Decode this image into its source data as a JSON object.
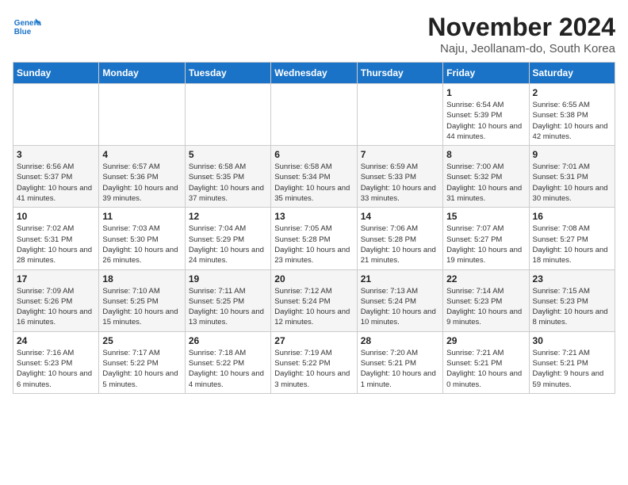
{
  "logo": {
    "line1": "General",
    "line2": "Blue"
  },
  "title": "November 2024",
  "subtitle": "Naju, Jeollanam-do, South Korea",
  "days_of_week": [
    "Sunday",
    "Monday",
    "Tuesday",
    "Wednesday",
    "Thursday",
    "Friday",
    "Saturday"
  ],
  "weeks": [
    [
      {
        "day": "",
        "info": ""
      },
      {
        "day": "",
        "info": ""
      },
      {
        "day": "",
        "info": ""
      },
      {
        "day": "",
        "info": ""
      },
      {
        "day": "",
        "info": ""
      },
      {
        "day": "1",
        "info": "Sunrise: 6:54 AM\nSunset: 5:39 PM\nDaylight: 10 hours and 44 minutes."
      },
      {
        "day": "2",
        "info": "Sunrise: 6:55 AM\nSunset: 5:38 PM\nDaylight: 10 hours and 42 minutes."
      }
    ],
    [
      {
        "day": "3",
        "info": "Sunrise: 6:56 AM\nSunset: 5:37 PM\nDaylight: 10 hours and 41 minutes."
      },
      {
        "day": "4",
        "info": "Sunrise: 6:57 AM\nSunset: 5:36 PM\nDaylight: 10 hours and 39 minutes."
      },
      {
        "day": "5",
        "info": "Sunrise: 6:58 AM\nSunset: 5:35 PM\nDaylight: 10 hours and 37 minutes."
      },
      {
        "day": "6",
        "info": "Sunrise: 6:58 AM\nSunset: 5:34 PM\nDaylight: 10 hours and 35 minutes."
      },
      {
        "day": "7",
        "info": "Sunrise: 6:59 AM\nSunset: 5:33 PM\nDaylight: 10 hours and 33 minutes."
      },
      {
        "day": "8",
        "info": "Sunrise: 7:00 AM\nSunset: 5:32 PM\nDaylight: 10 hours and 31 minutes."
      },
      {
        "day": "9",
        "info": "Sunrise: 7:01 AM\nSunset: 5:31 PM\nDaylight: 10 hours and 30 minutes."
      }
    ],
    [
      {
        "day": "10",
        "info": "Sunrise: 7:02 AM\nSunset: 5:31 PM\nDaylight: 10 hours and 28 minutes."
      },
      {
        "day": "11",
        "info": "Sunrise: 7:03 AM\nSunset: 5:30 PM\nDaylight: 10 hours and 26 minutes."
      },
      {
        "day": "12",
        "info": "Sunrise: 7:04 AM\nSunset: 5:29 PM\nDaylight: 10 hours and 24 minutes."
      },
      {
        "day": "13",
        "info": "Sunrise: 7:05 AM\nSunset: 5:28 PM\nDaylight: 10 hours and 23 minutes."
      },
      {
        "day": "14",
        "info": "Sunrise: 7:06 AM\nSunset: 5:28 PM\nDaylight: 10 hours and 21 minutes."
      },
      {
        "day": "15",
        "info": "Sunrise: 7:07 AM\nSunset: 5:27 PM\nDaylight: 10 hours and 19 minutes."
      },
      {
        "day": "16",
        "info": "Sunrise: 7:08 AM\nSunset: 5:27 PM\nDaylight: 10 hours and 18 minutes."
      }
    ],
    [
      {
        "day": "17",
        "info": "Sunrise: 7:09 AM\nSunset: 5:26 PM\nDaylight: 10 hours and 16 minutes."
      },
      {
        "day": "18",
        "info": "Sunrise: 7:10 AM\nSunset: 5:25 PM\nDaylight: 10 hours and 15 minutes."
      },
      {
        "day": "19",
        "info": "Sunrise: 7:11 AM\nSunset: 5:25 PM\nDaylight: 10 hours and 13 minutes."
      },
      {
        "day": "20",
        "info": "Sunrise: 7:12 AM\nSunset: 5:24 PM\nDaylight: 10 hours and 12 minutes."
      },
      {
        "day": "21",
        "info": "Sunrise: 7:13 AM\nSunset: 5:24 PM\nDaylight: 10 hours and 10 minutes."
      },
      {
        "day": "22",
        "info": "Sunrise: 7:14 AM\nSunset: 5:23 PM\nDaylight: 10 hours and 9 minutes."
      },
      {
        "day": "23",
        "info": "Sunrise: 7:15 AM\nSunset: 5:23 PM\nDaylight: 10 hours and 8 minutes."
      }
    ],
    [
      {
        "day": "24",
        "info": "Sunrise: 7:16 AM\nSunset: 5:23 PM\nDaylight: 10 hours and 6 minutes."
      },
      {
        "day": "25",
        "info": "Sunrise: 7:17 AM\nSunset: 5:22 PM\nDaylight: 10 hours and 5 minutes."
      },
      {
        "day": "26",
        "info": "Sunrise: 7:18 AM\nSunset: 5:22 PM\nDaylight: 10 hours and 4 minutes."
      },
      {
        "day": "27",
        "info": "Sunrise: 7:19 AM\nSunset: 5:22 PM\nDaylight: 10 hours and 3 minutes."
      },
      {
        "day": "28",
        "info": "Sunrise: 7:20 AM\nSunset: 5:21 PM\nDaylight: 10 hours and 1 minute."
      },
      {
        "day": "29",
        "info": "Sunrise: 7:21 AM\nSunset: 5:21 PM\nDaylight: 10 hours and 0 minutes."
      },
      {
        "day": "30",
        "info": "Sunrise: 7:21 AM\nSunset: 5:21 PM\nDaylight: 9 hours and 59 minutes."
      }
    ]
  ]
}
